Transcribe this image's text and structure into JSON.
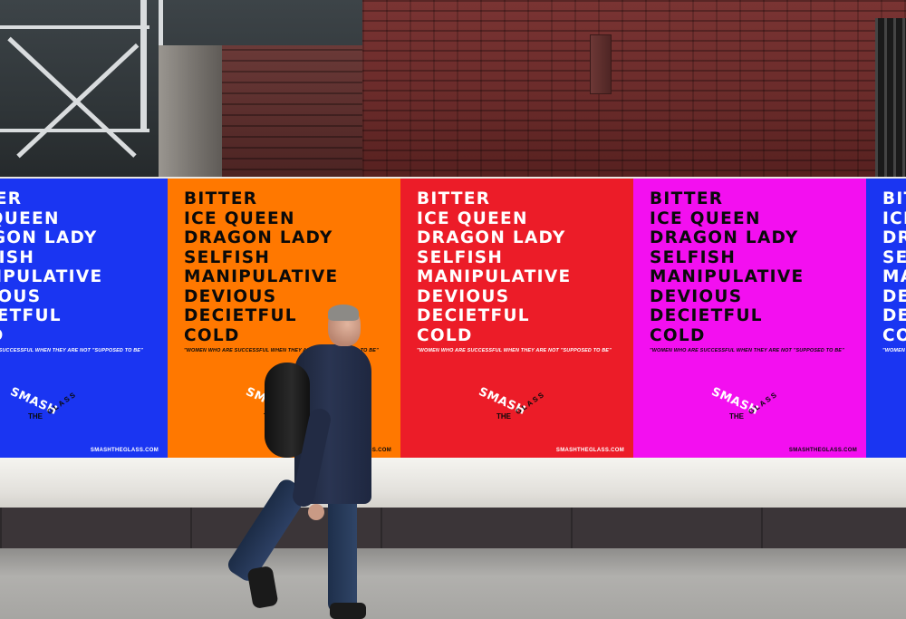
{
  "poster": {
    "words": [
      "BITTER",
      "ICE QUEEN",
      "DRAGON LADY",
      "SELFISH",
      "MANIPULATIVE",
      "DEVIOUS",
      "DECIETFUL",
      "COLD"
    ],
    "quote": "\"WOMEN WHO ARE SUCCESSFUL WHEN THEY ARE NOT \"SUPPOSED TO BE\"",
    "logo_line1": "SMASH",
    "logo_line2": "THE",
    "logo_line3": "GLASS",
    "url": "SMASHTHEGLASS.COM"
  },
  "poster_colors": {
    "blue": "#1a35f2",
    "orange": "#ff7800",
    "red": "#ec1c28",
    "magenta": "#f30ff0"
  }
}
